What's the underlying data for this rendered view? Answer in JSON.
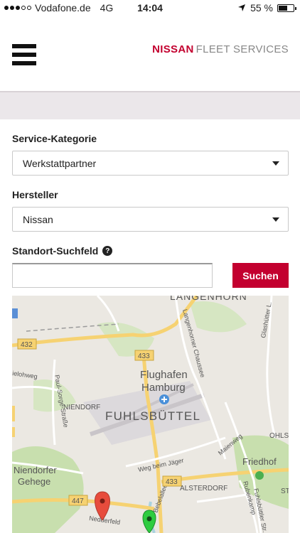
{
  "status_bar": {
    "carrier": "Vodafone.de",
    "network": "4G",
    "time": "14:04",
    "battery": "55 %"
  },
  "header": {
    "brand_primary": "NISSAN",
    "brand_secondary": "FLEET SERVICES"
  },
  "form": {
    "category_label": "Service-Kategorie",
    "category_value": "Werkstattpartner",
    "manufacturer_label": "Hersteller",
    "manufacturer_value": "Nissan",
    "location_label": "Standort-Suchfeld",
    "location_value": "",
    "search_button": "Suchen"
  },
  "map": {
    "labels": {
      "langenhorn": "LANGENHORN",
      "airport_1": "Flughafen",
      "airport_2": "Hamburg",
      "fuhlsbuettel": "FUHLSBÜTTEL",
      "niendorf": "NIENDORF",
      "niendorfer_1": "Niendorfer",
      "niendorfer_2": "Gehege",
      "alsterdorf": "ALSTERDORF",
      "friedhof": "Friedhof",
      "langenhorner_chaussee": "Langenhorner Chaussee",
      "weg_beim_jaeger": "Weg beim Jäger",
      "paul_sorge": "Paul-Sorge-Straße",
      "maienweg": "Maienweg",
      "rubenkamp": "Rubenkamp",
      "fuhlsbuettler": "Fuhlsbüttler Str.",
      "nedderfeld": "Nedderfeld",
      "bebelallee": "Bebelallee",
      "glashuetter": "Glashütter L.",
      "ohls": "OHLS",
      "st": "ST",
      "ielohweg": "ielohweg",
      "road_432": "432",
      "road_433a": "433",
      "road_433b": "433",
      "road_447": "447"
    },
    "colors": {
      "accent": "#c3002f",
      "park": "#c8dfae",
      "water": "#aad3df",
      "road_yellow": "#f6d272",
      "marker_red": "#e74c3c",
      "marker_green": "#2ecc40"
    }
  }
}
